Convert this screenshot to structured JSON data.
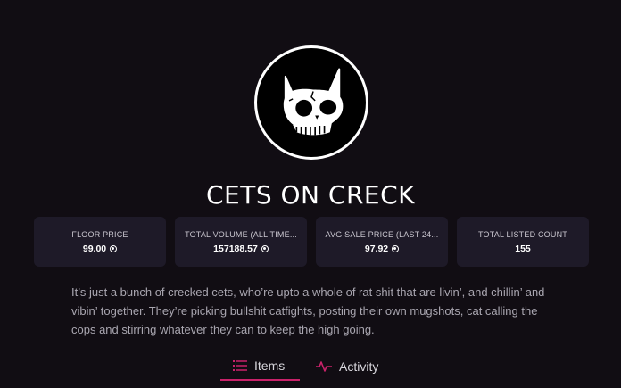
{
  "collection": {
    "title": "CETS ON CRECK",
    "avatar_icon": "skull-cat-icon"
  },
  "stats": [
    {
      "label": "FLOOR PRICE",
      "value": "99.00",
      "icon": "coin-icon"
    },
    {
      "label": "TOTAL VOLUME (ALL TIME...",
      "value": "157188.57",
      "icon": "coin-icon"
    },
    {
      "label": "AVG SALE PRICE (LAST 24...",
      "value": "97.92",
      "icon": "coin-icon"
    },
    {
      "label": "TOTAL LISTED COUNT",
      "value": "155",
      "icon": ""
    }
  ],
  "description": "It’s just a bunch of crecked cets, who’re upto a whole of rat shit that are livin’, and chillin’ and vibin’ together. They’re picking bullshit catfights, posting their own mugshots, cat calling the cops and stirring whatever they can to keep the high going.",
  "tabs": [
    {
      "label": "Items",
      "icon": "list-icon",
      "active": true
    },
    {
      "label": "Activity",
      "icon": "activity-icon",
      "active": false
    }
  ],
  "colors": {
    "background": "#110d13",
    "card": "#1e1a28",
    "accent": "#c9226a",
    "muted_text": "#a9a6b0"
  }
}
